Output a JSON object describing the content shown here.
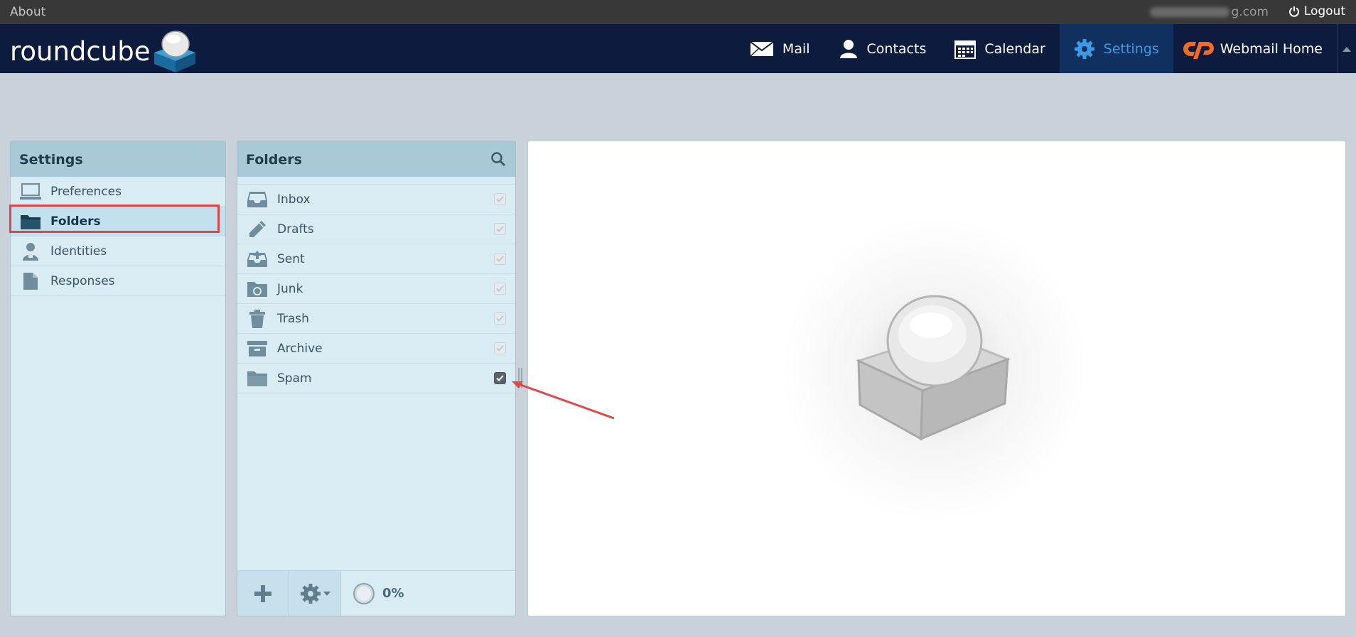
{
  "topbar": {
    "about": "About",
    "email_suffix": "g.com",
    "logout": "Logout"
  },
  "header": {
    "logo_text": "roundcube",
    "nav": [
      {
        "label": "Mail",
        "icon": "mail-icon"
      },
      {
        "label": "Contacts",
        "icon": "contacts-icon"
      },
      {
        "label": "Calendar",
        "icon": "calendar-icon"
      },
      {
        "label": "Settings",
        "icon": "settings-icon",
        "active": true
      },
      {
        "label": "Webmail Home",
        "icon": "cpanel-icon"
      }
    ]
  },
  "settings_panel": {
    "title": "Settings",
    "items": [
      {
        "label": "Preferences",
        "icon": "laptop-icon"
      },
      {
        "label": "Folders",
        "icon": "folder-icon",
        "selected": true
      },
      {
        "label": "Identities",
        "icon": "identity-icon"
      },
      {
        "label": "Responses",
        "icon": "document-icon"
      }
    ]
  },
  "folders_panel": {
    "title": "Folders",
    "folders": [
      {
        "label": "Inbox",
        "icon": "inbox-icon",
        "subscribed": true,
        "locked": true
      },
      {
        "label": "Drafts",
        "icon": "pencil-icon",
        "subscribed": true,
        "locked": true
      },
      {
        "label": "Sent",
        "icon": "sent-icon",
        "subscribed": true,
        "locked": true
      },
      {
        "label": "Junk",
        "icon": "junk-icon",
        "subscribed": true,
        "locked": true
      },
      {
        "label": "Trash",
        "icon": "trash-icon",
        "subscribed": true,
        "locked": true
      },
      {
        "label": "Archive",
        "icon": "archive-icon",
        "subscribed": true,
        "locked": true
      },
      {
        "label": "Spam",
        "icon": "folder-icon",
        "subscribed": true,
        "locked": false
      }
    ],
    "quota": "0%"
  },
  "colors": {
    "header": "#0c1b3e",
    "accent": "#3c9ae4",
    "highlight": "#de4545",
    "panel": "#d9ebf3"
  }
}
